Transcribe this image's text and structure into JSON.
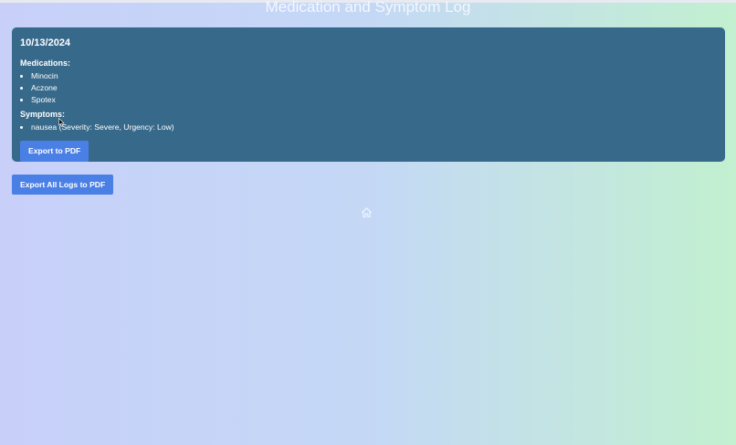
{
  "header": {
    "title": "Medication and Symptom Log"
  },
  "logs": [
    {
      "date": "10/13/2024",
      "medications_label": "Medications:",
      "medications": [
        "Minocin",
        "Aczone",
        "Spotex"
      ],
      "symptoms_label": "Symptoms:",
      "symptoms": [
        "nausea (Severity: Severe, Urgency: Low)"
      ],
      "export_label": "Export to PDF"
    }
  ],
  "actions": {
    "export_all_label": "Export All Logs to PDF"
  },
  "icons": {
    "home": "home-icon"
  },
  "colors": {
    "card": "#37698b",
    "button": "#4a80e6",
    "text": "#ffffff"
  }
}
